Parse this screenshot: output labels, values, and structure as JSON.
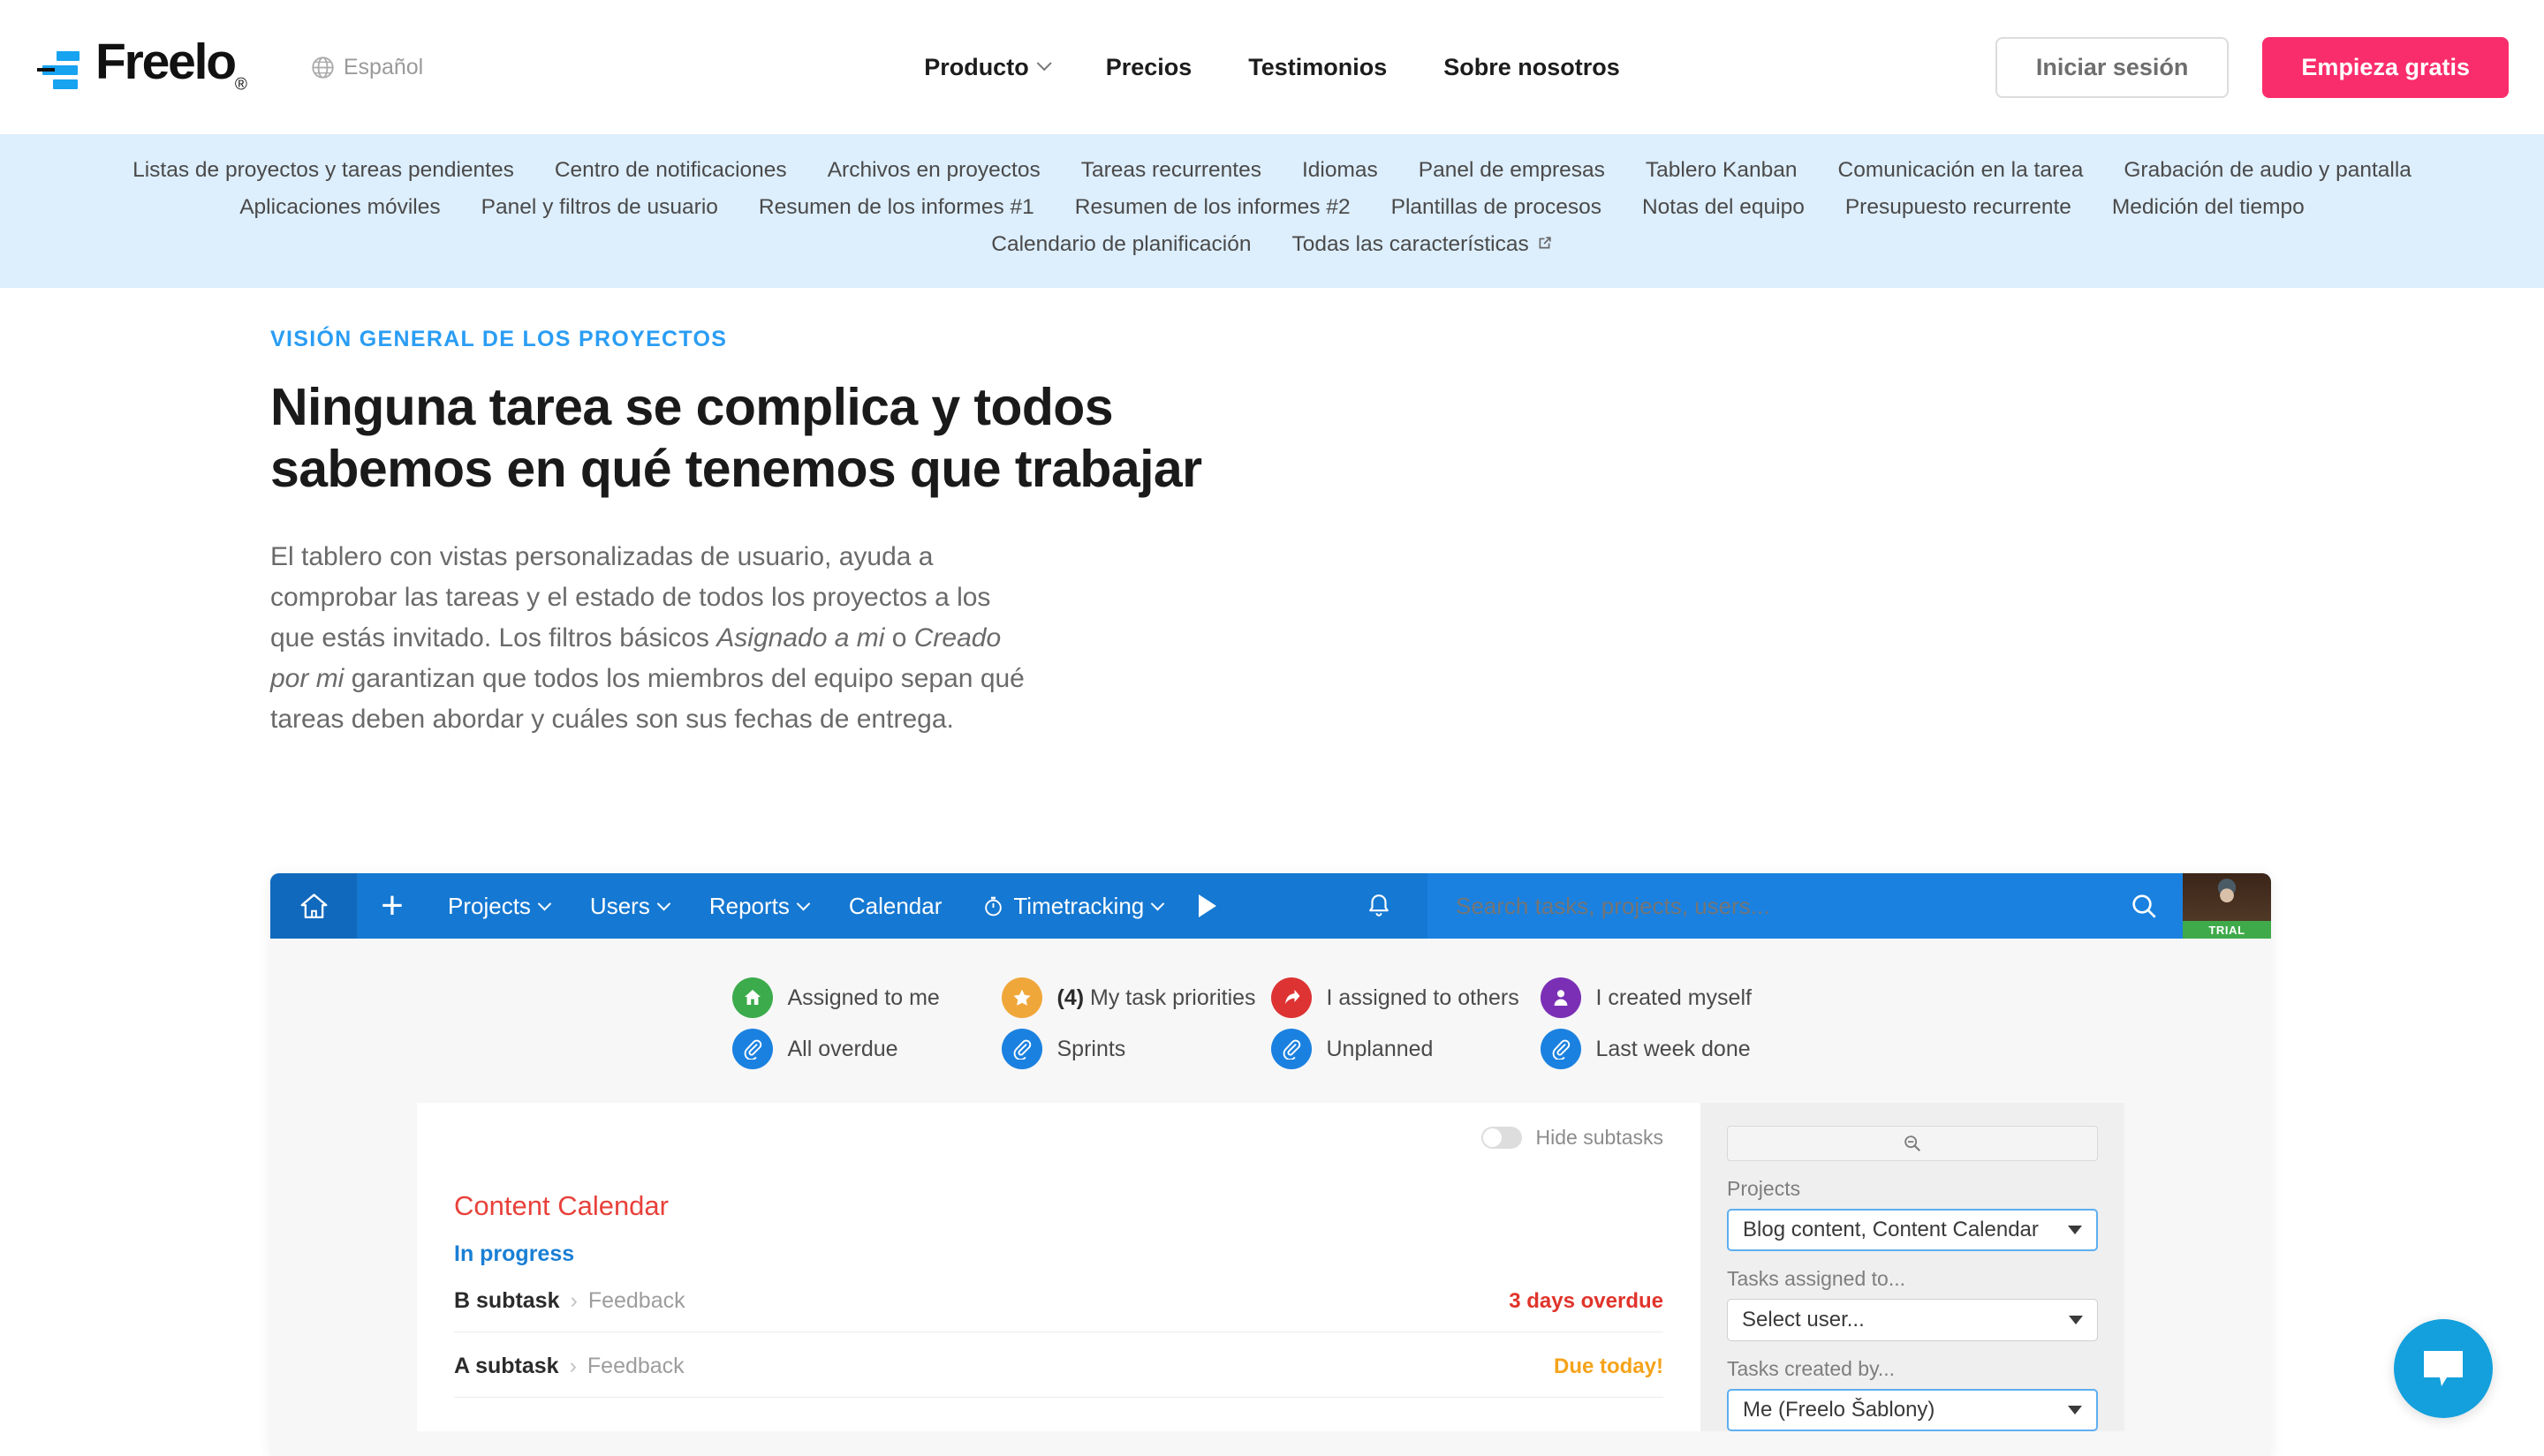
{
  "header": {
    "logo_text": "Freelo",
    "logo_registered": "®",
    "language": "Español",
    "nav": [
      {
        "label": "Producto",
        "has_caret": true
      },
      {
        "label": "Precios",
        "has_caret": false
      },
      {
        "label": "Testimonios",
        "has_caret": false
      },
      {
        "label": "Sobre nosotros",
        "has_caret": false
      }
    ],
    "login_label": "Iniciar sesión",
    "signup_label": "Empieza gratis",
    "accent_pink": "#fa2d6c"
  },
  "subnav": {
    "background": "#ddeefc",
    "row1": [
      "Listas de proyectos y tareas pendientes",
      "Centro de notificaciones",
      "Archivos en proyectos",
      "Tareas recurrentes",
      "Idiomas",
      "Panel de empresas",
      "Tablero Kanban",
      "Comunicación en la tarea",
      "Grabación de audio y pantalla"
    ],
    "row2": [
      "Aplicaciones móviles",
      "Panel y filtros de usuario",
      "Resumen de los informes #1",
      "Resumen de los informes #2",
      "Plantillas de procesos",
      "Notas del equipo",
      "Presupuesto recurrente",
      "Medición del tiempo"
    ],
    "row3": [
      {
        "label": "Calendario de planificación",
        "external": false
      },
      {
        "label": "Todas las características",
        "external": true
      }
    ]
  },
  "hero": {
    "eyebrow": "VISIÓN GENERAL DE LOS PROYECTOS",
    "eyebrow_color": "#2a9df4",
    "title": "Ninguna tarea se complica y todos sabemos en qué tenemos que trabajar",
    "body_part1": "El tablero con vistas personalizadas de usuario, ayuda a comprobar las tareas y el estado de todos los proyectos a los que estás invitado. Los filtros básicos ",
    "body_em1": "Asignado a mi",
    "body_mid": " o ",
    "body_em2": "Creado por mi",
    "body_part2": " garantizan que todos los miembros del equipo sepan qué tareas deben abordar y cuáles son sus fechas de entrega."
  },
  "app": {
    "toolbar": {
      "home_icon": "home-icon",
      "add_label": "+",
      "items": [
        {
          "label": "Projects",
          "caret": true,
          "timer": false
        },
        {
          "label": "Users",
          "caret": true,
          "timer": false
        },
        {
          "label": "Reports",
          "caret": true,
          "timer": false
        },
        {
          "label": "Calendar",
          "caret": false,
          "timer": false
        },
        {
          "label": "Timetracking",
          "caret": true,
          "timer": true
        }
      ],
      "search_placeholder": "Search tasks, projects, users...",
      "search_value": "",
      "trial_badge": "TRIAL",
      "bg_color": "#1578d2"
    },
    "filters_row1": [
      {
        "label": "Assigned to me",
        "count": "",
        "color": "#3cab4c",
        "icon": "home-circle-icon"
      },
      {
        "label": "My task priorities",
        "count": "(4)",
        "color": "#f0a73a",
        "icon": "star-icon"
      },
      {
        "label": "I assigned to others",
        "count": "",
        "color": "#dd3333",
        "icon": "arrow-share-icon"
      },
      {
        "label": "I created myself",
        "count": "",
        "color": "#7a2fb5",
        "icon": "person-icon"
      }
    ],
    "filters_row2": [
      {
        "label": "All overdue",
        "count": "",
        "color": "#1a81e0",
        "icon": "clip-icon"
      },
      {
        "label": "Sprints",
        "count": "",
        "color": "#1a81e0",
        "icon": "clip-icon"
      },
      {
        "label": "Unplanned",
        "count": "",
        "color": "#1a81e0",
        "icon": "clip-icon"
      },
      {
        "label": "Last week done",
        "count": "",
        "color": "#1a81e0",
        "icon": "clip-icon"
      }
    ],
    "task_panel": {
      "hide_subtasks_label": "Hide subtasks",
      "hide_subtasks_on": false,
      "project_title": "Content Calendar",
      "project_title_color": "#e8413a",
      "status_label": "In progress",
      "status_color": "#1a7fd4",
      "rows": [
        {
          "name": "B subtask",
          "separator": "›",
          "parent": "Feedback",
          "due": "3 days overdue",
          "due_state": "overdue"
        },
        {
          "name": "A subtask",
          "separator": "›",
          "parent": "Feedback",
          "due": "Due today!",
          "due_state": "today"
        }
      ]
    },
    "filter_panel": {
      "search_value": "",
      "fields": [
        {
          "label": "Projects",
          "value": "Blog content, Content Calendar",
          "focused": true
        },
        {
          "label": "Tasks assigned to...",
          "value": "Select user...",
          "focused": false
        },
        {
          "label": "Tasks created by...",
          "value": "Me (Freelo Šablony)",
          "focused": true
        }
      ]
    }
  },
  "chat": {
    "icon": "chat-bubble-icon",
    "color": "#13a0dd"
  }
}
